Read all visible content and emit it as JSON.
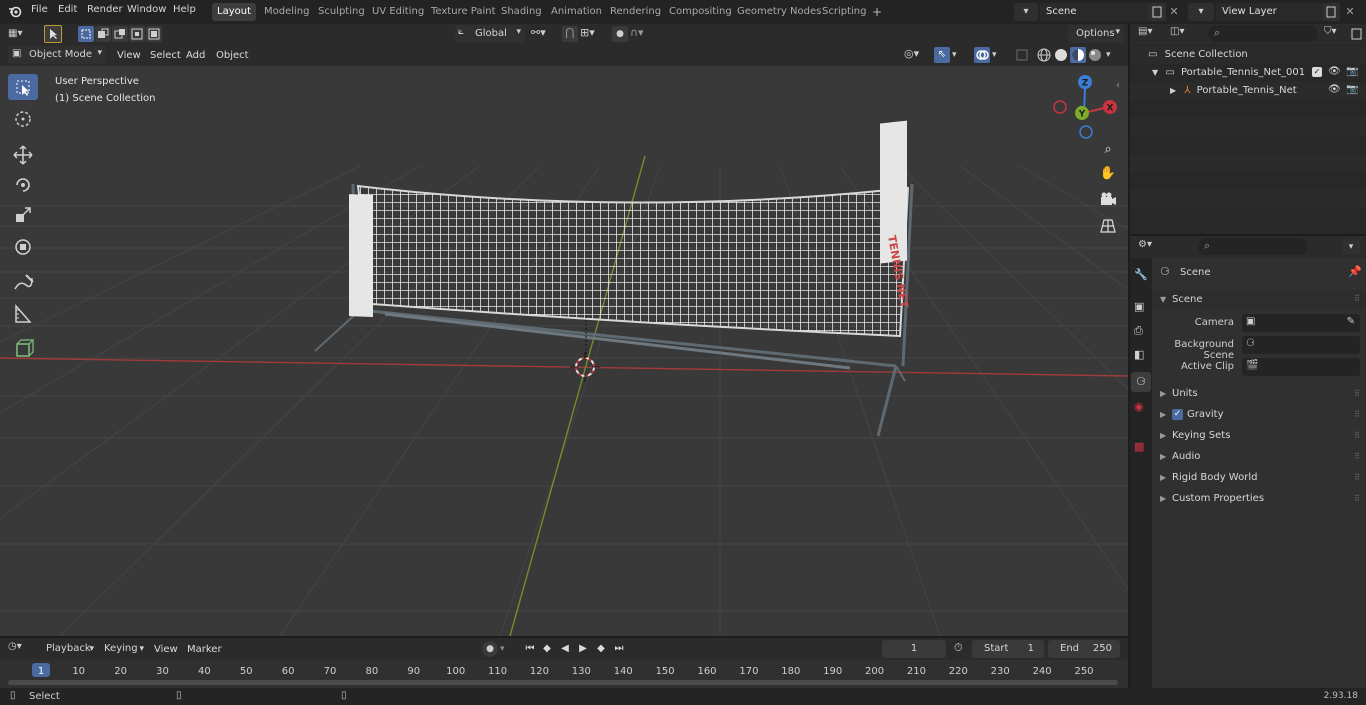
{
  "menu": {
    "items": [
      "File",
      "Edit",
      "Render",
      "Window",
      "Help"
    ]
  },
  "workspaces": {
    "tabs": [
      "Layout",
      "Modeling",
      "Sculpting",
      "UV Editing",
      "Texture Paint",
      "Shading",
      "Animation",
      "Rendering",
      "Compositing",
      "Geometry Nodes",
      "Scripting"
    ],
    "active": "Layout",
    "add_symbol": "+"
  },
  "scene": {
    "name": "Scene"
  },
  "view_layer": {
    "name": "View Layer"
  },
  "viewport_header": {
    "mode": "Object Mode",
    "menus": [
      "View",
      "Select",
      "Add",
      "Object"
    ],
    "orientation": "Global",
    "options_label": "Options"
  },
  "viewport": {
    "perspective": "User Perspective",
    "collection": "(1) Scene Collection",
    "net_label": "TENNIS NET",
    "gizmo": {
      "x": "X",
      "y": "Y",
      "z": "Z"
    }
  },
  "outliner": {
    "root": "Scene Collection",
    "items": [
      {
        "name": "Portable_Tennis_Net_001"
      },
      {
        "name": "Portable_Tennis_Net"
      }
    ]
  },
  "properties": {
    "context": "Scene",
    "section": "Scene",
    "fields": [
      {
        "label": "Camera"
      },
      {
        "label": "Background Scene"
      },
      {
        "label": "Active Clip"
      }
    ],
    "panels": [
      "Units",
      "Gravity",
      "Keying Sets",
      "Audio",
      "Rigid Body World",
      "Custom Properties"
    ]
  },
  "timeline": {
    "menus": [
      "Playback",
      "Keying",
      "View",
      "Marker"
    ],
    "current_frame": "1",
    "start_label": "Start",
    "start": "1",
    "end_label": "End",
    "end": "250",
    "ticks": [
      "1",
      "10",
      "20",
      "30",
      "40",
      "50",
      "60",
      "70",
      "80",
      "90",
      "100",
      "110",
      "120",
      "130",
      "140",
      "150",
      "160",
      "170",
      "180",
      "190",
      "200",
      "210",
      "220",
      "230",
      "240",
      "250"
    ]
  },
  "status": {
    "select_label": "Select",
    "version": "2.93.18"
  },
  "colors": {
    "accent": "#4a6aa0",
    "x_axis": "#c8343f",
    "y_axis": "#7fab2a",
    "z_axis": "#3b7ed6"
  }
}
